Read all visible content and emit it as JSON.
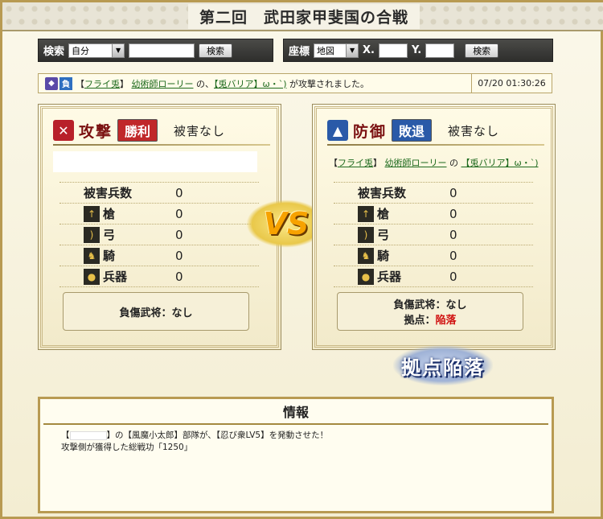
{
  "title": "第二回　武田家甲斐国の合戦",
  "search": {
    "label": "検索",
    "select_value": "自分",
    "input_value": "",
    "button_label": "検索"
  },
  "coords": {
    "label": "座標",
    "select_value": "地図",
    "x_label": "X.",
    "y_label": "Y.",
    "x_value": "",
    "y_value": "",
    "button_label": "検索"
  },
  "notice": {
    "icon_a": "flag-icon",
    "neg_label": "負",
    "attacker_bracket_open": "【",
    "attacker_name": "フライ兎",
    "attacker_bracket_close": "】",
    "general_name": "幼術師ローリー",
    "mid_text": "の、",
    "defender_name": "【兎バリア】ω・`)",
    "tail_text": "が攻撃されました。",
    "time": "07/20 01:30:26"
  },
  "attack": {
    "role_label": "攻撃",
    "result_label": "勝利",
    "damage_label": "被害なし",
    "attacker_name": ""
  },
  "defense": {
    "role_label": "防御",
    "result_label": "敗退",
    "damage_label": "被害なし",
    "open": "【",
    "name": "フライ兎",
    "close": "】",
    "general": "幼術師ローリー",
    "mid": "の",
    "ally": "【兎バリア】ω・`)"
  },
  "stats": {
    "total_label": "被害兵数",
    "spear_label": "槍",
    "bow_label": "弓",
    "cavalry_label": "騎",
    "weapon_label": "兵器"
  },
  "attack_stats": {
    "total": "0",
    "spear": "0",
    "bow": "0",
    "cavalry": "0",
    "weapon": "0"
  },
  "defense_stats": {
    "total": "0",
    "spear": "0",
    "bow": "0",
    "cavalry": "0",
    "weapon": "0"
  },
  "attack_wounded": "負傷武将：なし",
  "defense_wounded": "負傷武将：なし",
  "defense_base_label": "拠点：",
  "defense_base_value": "陥落",
  "vs_label": "VS",
  "stamp_label": "拠点陥落",
  "info": {
    "title": "情報",
    "line1_open": "【",
    "line1_rest": "】の【風魔小太郎】部隊が、【忍び衆LV5】を発動させた！",
    "line2": "攻撃側が獲得した総戦功「1250」"
  },
  "colors": {
    "win": "#c0282a",
    "lose": "#2a5aa8",
    "gold_border": "#b89a52",
    "fallen": "#d01010"
  }
}
